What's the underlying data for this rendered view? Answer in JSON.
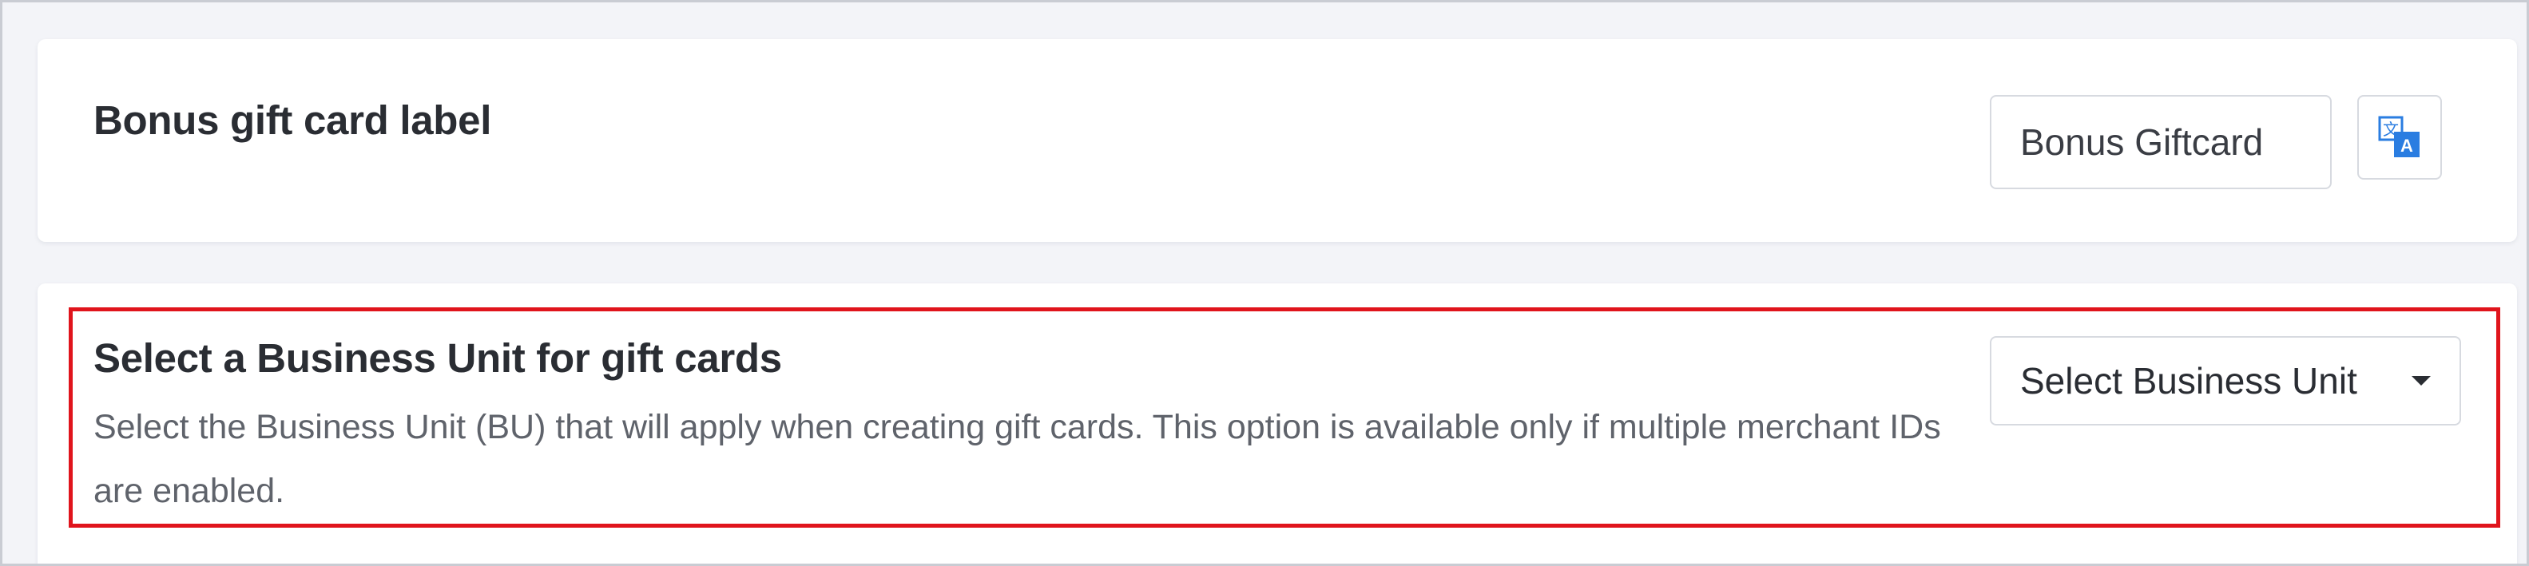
{
  "bonus_label_section": {
    "title": "Bonus gift card label",
    "input_value": "Bonus Giftcard",
    "translate_icon": "translate-icon"
  },
  "business_unit_section": {
    "title": "Select a Business Unit for gift cards",
    "description": "Select the Business Unit (BU) that will apply when creating gift cards. This option is available only if multiple merchant IDs are enabled.",
    "select_value": "Select Business Unit",
    "dropdown_icon": "chevron-down-icon"
  },
  "colors": {
    "highlight": "#e0141c",
    "translate_icon": "#2a7de1",
    "background": "#f3f4f8"
  }
}
